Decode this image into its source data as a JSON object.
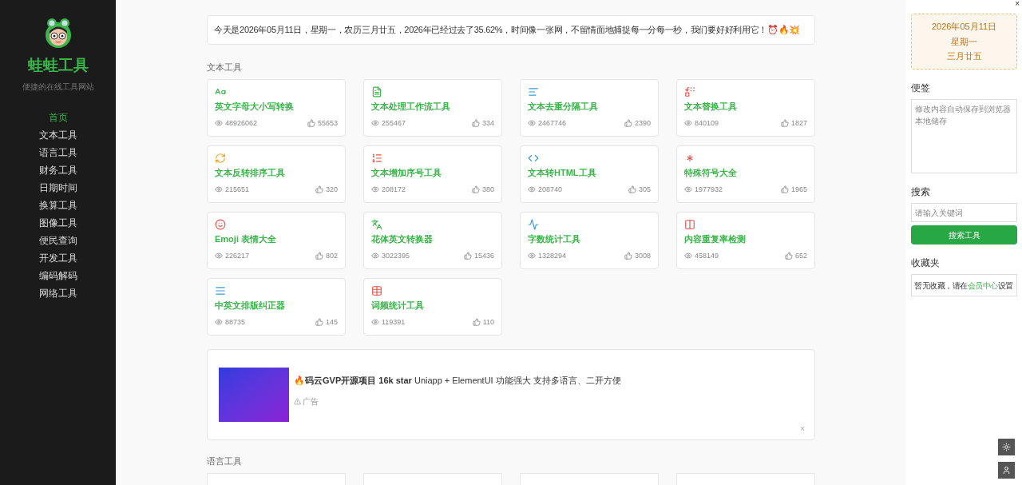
{
  "sidebar": {
    "logo_title": "蛙蛙工具",
    "tagline": "便捷的在线工具网站",
    "nav": [
      {
        "label": "首页",
        "selected": true
      },
      {
        "label": "文本工具",
        "selected": false
      },
      {
        "label": "语言工具",
        "selected": false
      },
      {
        "label": "财务工具",
        "selected": false
      },
      {
        "label": "日期时间",
        "selected": false
      },
      {
        "label": "换算工具",
        "selected": false
      },
      {
        "label": "图像工具",
        "selected": false
      },
      {
        "label": "便民查询",
        "selected": false
      },
      {
        "label": "开发工具",
        "selected": false
      },
      {
        "label": "编码解码",
        "selected": false
      },
      {
        "label": "网络工具",
        "selected": false
      }
    ]
  },
  "notice": "今天是2026年05月11日，星期一，农历三月廿五，2026年已经过去了35.62%，时间像一张网，不留情面地捕捉每一分每一秒，我们要好好利用它！⏰🔥💥",
  "sections": [
    {
      "title": "文本工具",
      "tools": [
        {
          "name": "英文字母大小写转换",
          "views": "48926062",
          "likes": "55653"
        },
        {
          "name": "文本处理工作流工具",
          "views": "255467",
          "likes": "334"
        },
        {
          "name": "文本去重分隔工具",
          "views": "2467746",
          "likes": "2390"
        },
        {
          "name": "文本替换工具",
          "views": "840109",
          "likes": "1827"
        },
        {
          "name": "文本反转排序工具",
          "views": "215651",
          "likes": "320"
        },
        {
          "name": "文本增加序号工具",
          "views": "208172",
          "likes": "380"
        },
        {
          "name": "文本转HTML工具",
          "views": "208740",
          "likes": "305"
        },
        {
          "name": "特殊符号大全",
          "views": "1977932",
          "likes": "1965"
        },
        {
          "name": "Emoji 表情大全",
          "views": "226217",
          "likes": "802"
        },
        {
          "name": "花体英文转换器",
          "views": "3022395",
          "likes": "15436"
        },
        {
          "name": "字数统计工具",
          "views": "1328294",
          "likes": "3008"
        },
        {
          "name": "内容重复率检测",
          "views": "458149",
          "likes": "652"
        },
        {
          "name": "中英文排版纠正器",
          "views": "88735",
          "likes": "145"
        },
        {
          "name": "词频统计工具",
          "views": "119391",
          "likes": "110"
        }
      ]
    }
  ],
  "ad": {
    "text": "🔥**码云GVP开源项目 16k star** Uniapp + ElementUI 功能强大 支持多语言、二开方便",
    "label": "广告",
    "close": "×"
  },
  "next_section": {
    "title": "语言工具"
  },
  "right_panel": {
    "close": "×",
    "date": "2026年05月11日",
    "weekday": "星期一",
    "lunar": "三月廿五",
    "notes": {
      "title": "便签",
      "placeholder": "修改内容自动保存到浏览器本地储存"
    },
    "search": {
      "title": "搜索",
      "placeholder": "请输入关键词",
      "button": "搜索工具"
    },
    "favorites": {
      "title": "收藏夹",
      "text_before": "暂无收藏，请在",
      "link": "会员中心",
      "text_after": "设置"
    }
  }
}
